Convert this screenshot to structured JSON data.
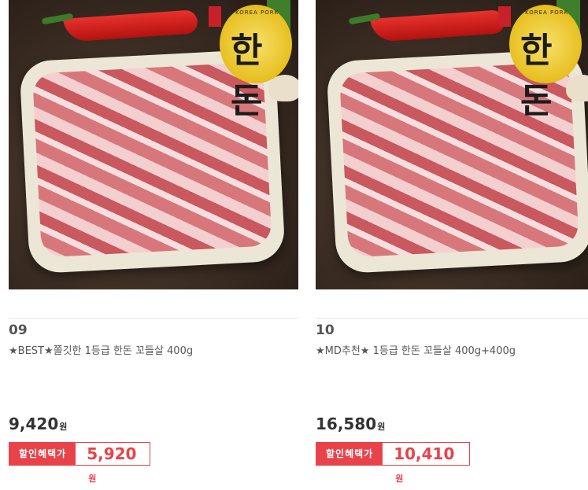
{
  "products": [
    {
      "rank": "09",
      "title": "★BEST★쫄깃한 1등급 한돈 꼬들살 400g",
      "price": "9,420",
      "price_unit": "원",
      "sale_label": "할인혜택가",
      "sale_price": "5,920",
      "sale_unit": "원",
      "badge_text": "KOREA PORK",
      "badge_logo": "한돈"
    },
    {
      "rank": "10",
      "title": "★MD추천★ 1등급 한돈 꼬들살 400g+400g",
      "price": "16,580",
      "price_unit": "원",
      "sale_label": "할인혜택가",
      "sale_price": "10,410",
      "sale_unit": "원",
      "badge_text": "KOREA PORK",
      "badge_logo": "한돈"
    }
  ],
  "colors": {
    "accent": "#e8434a",
    "text": "#333333",
    "muted": "#555555",
    "divider": "#e6e6e6"
  }
}
